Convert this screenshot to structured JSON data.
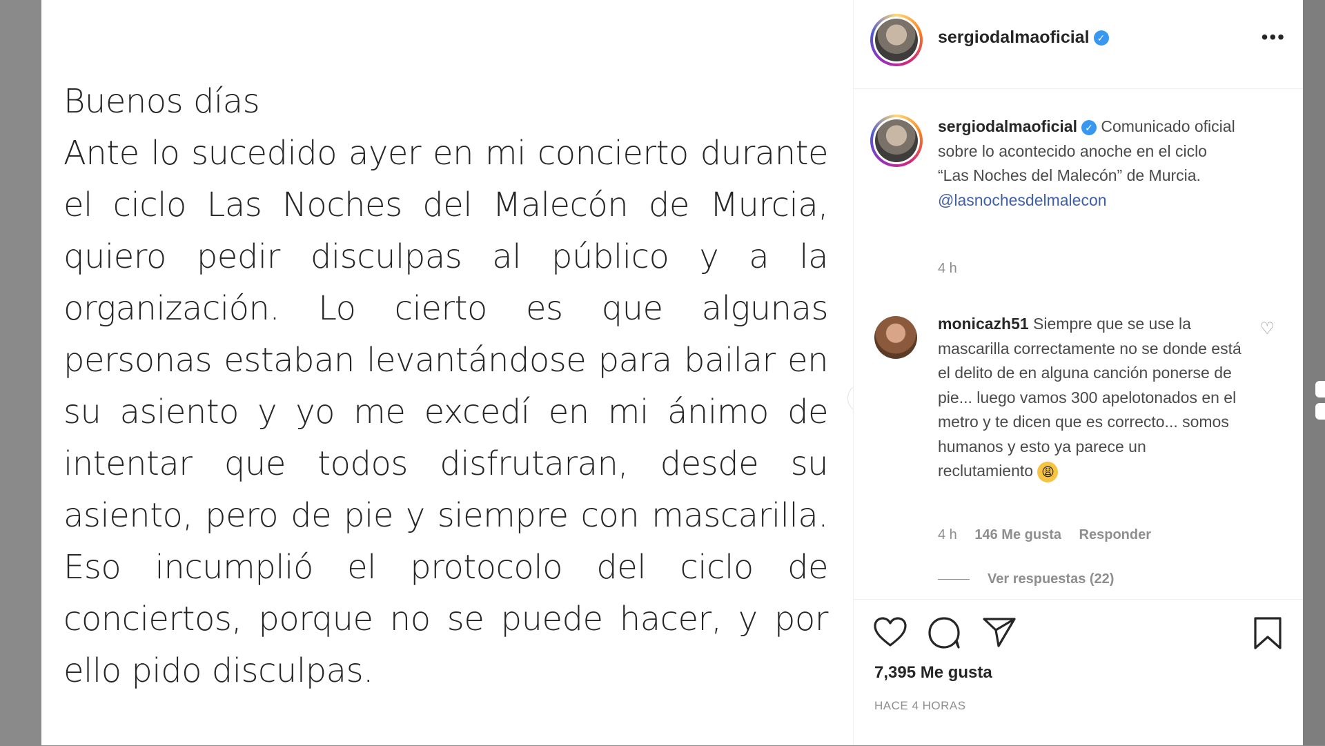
{
  "post": {
    "text": "Buenos días\nAnte lo sucedido ayer en mi concierto durante el ciclo Las Noches del Malecón de Murcia, quiero pedir disculpas al público y a la organización. Lo cierto es que algunas personas estaban levantándose para bailar en su asiento y yo me excedí en mi ánimo de intentar que todos disfrutaran, desde su asiento, pero de pie y siempre con mascarilla. Eso incumplió el protocolo del ciclo de conciertos, porque no se puede hacer, y por ello pido disculpas."
  },
  "header": {
    "username": "sergiodalmaoficial",
    "verified": true,
    "more_icon": "more-horizontal-icon"
  },
  "caption": {
    "username": "sergiodalmaoficial",
    "text": "Comunicado oficial sobre lo acontecido anoche en el ciclo “Las Noches del Malecón” de Murcia.",
    "mention": "@lasnochesdelmalecon",
    "time": "4 h"
  },
  "comment": {
    "username": "monicazh51",
    "text": "Siempre que se use la mascarilla correctamente no se donde está el delito de en alguna canción ponerse de pie... luego vamos 300 apelotonados en el metro y te dicen que es correcto... somos humanos y esto ya parece un reclutamiento",
    "emoji_icon": "weary-face-emoji",
    "time": "4 h",
    "likes": "146 Me gusta",
    "reply": "Responder",
    "view_replies": "Ver respuestas (22)"
  },
  "actions": {
    "likes": "7,395 Me gusta",
    "timestamp": "HACE 4 HORAS",
    "icons": [
      "heart-icon",
      "comment-icon",
      "share-icon",
      "bookmark-icon"
    ]
  },
  "colors": {
    "text": "#262626",
    "secondary": "#8e8e8e",
    "link": "#3f5ea8",
    "verified": "#3897f0"
  }
}
